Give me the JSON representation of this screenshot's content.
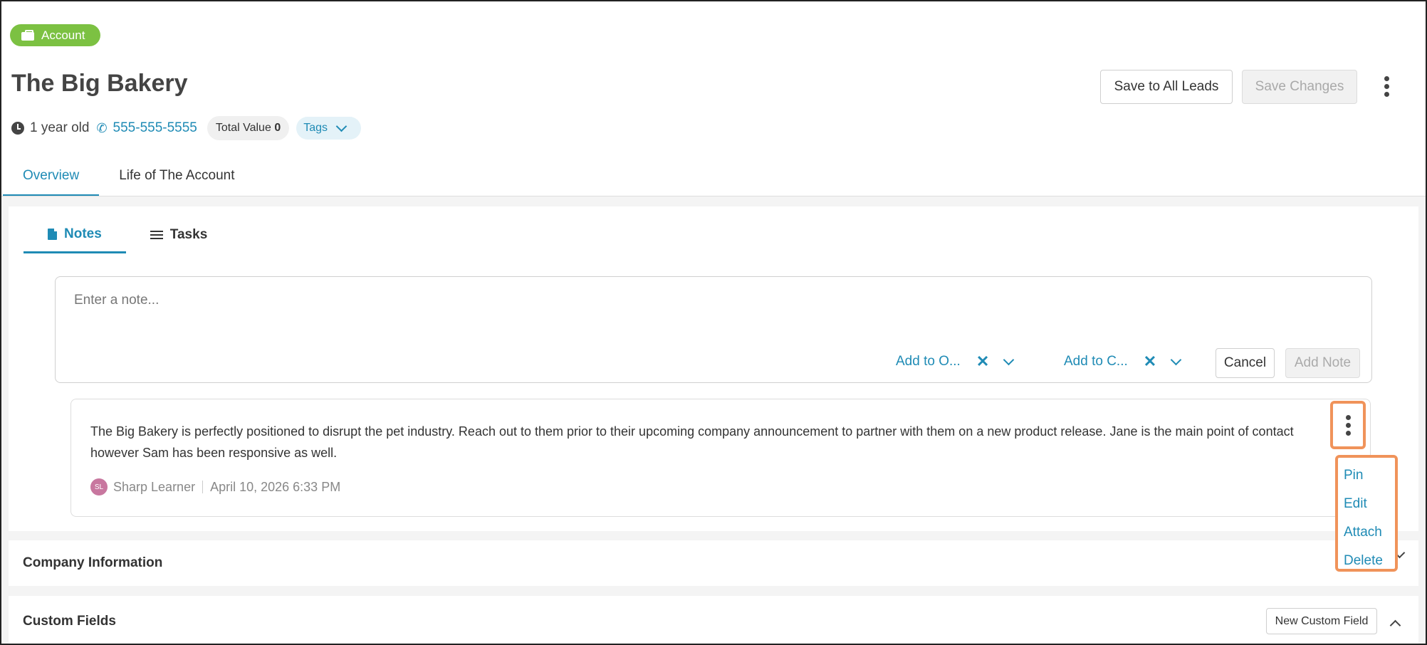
{
  "record": {
    "type_badge": "Account",
    "title": "The Big Bakery",
    "age": "1 year old",
    "phone": "555-555-5555",
    "total_value_label": "Total Value",
    "total_value": "0",
    "tags_label": "Tags"
  },
  "header_actions": {
    "save_to_all_leads": "Save to All Leads",
    "save_changes": "Save Changes"
  },
  "main_tabs": [
    {
      "label": "Overview",
      "active": true
    },
    {
      "label": "Life of The Account",
      "active": false
    }
  ],
  "sub_tabs": [
    {
      "label": "Notes",
      "active": true
    },
    {
      "label": "Tasks",
      "active": false
    }
  ],
  "note_composer": {
    "placeholder": "Enter a note...",
    "add_to_opportunity": "Add to O...",
    "add_to_contact": "Add to C...",
    "clear_glyph": "✕",
    "cancel": "Cancel",
    "add_note": "Add Note"
  },
  "notes": [
    {
      "text": "The Big Bakery is perfectly positioned to disrupt the pet industry. Reach out to them prior to their upcoming company announcement to partner with them on a new product release. Jane is the main point of contact however Sam has been responsive as well.",
      "author_initials": "SL",
      "author": "Sharp Learner",
      "timestamp": "April 10, 2026 6:33 PM"
    }
  ],
  "note_menu": [
    "Pin",
    "Edit",
    "Attach",
    "Delete"
  ],
  "sections": {
    "company_information": "Company Information",
    "custom_fields": "Custom Fields",
    "new_custom_field": "New Custom Field"
  },
  "colors": {
    "accent": "#1f8bb5",
    "badge_green": "#7cc142",
    "highlight_orange": "#f0935a"
  }
}
